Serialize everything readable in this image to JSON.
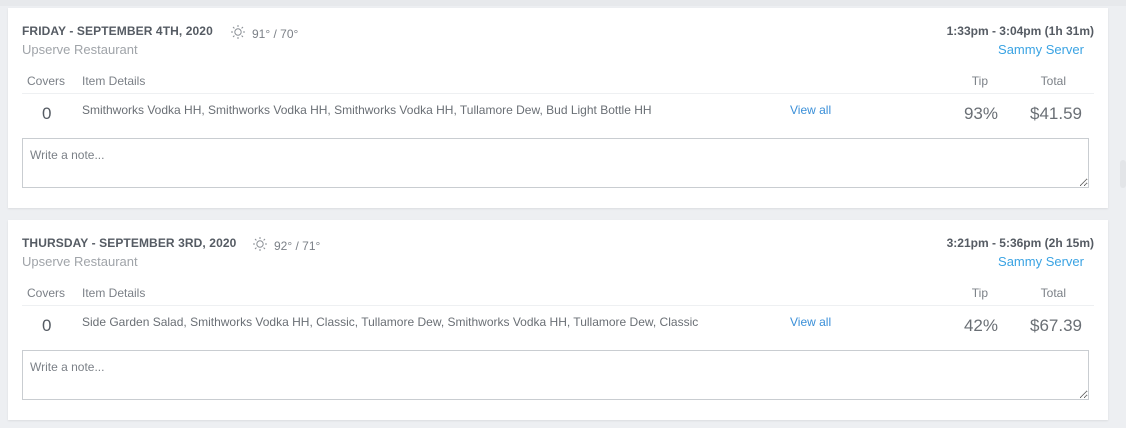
{
  "orders": [
    {
      "date": "FRIDAY - SEPTEMBER 4TH, 2020",
      "weather": "91° / 70°",
      "restaurant": "Upserve Restaurant",
      "time": "1:33pm - 3:04pm (1h 31m)",
      "server": "Sammy Server",
      "headers": {
        "covers": "Covers",
        "items": "Item Details",
        "tip": "Tip",
        "total": "Total"
      },
      "covers": "0",
      "items": "Smithworks Vodka HH, Smithworks Vodka HH, Smithworks Vodka HH, Tullamore Dew, Bud Light Bottle HH",
      "view_all": "View all",
      "tip": "93%",
      "total": "$41.59",
      "note_placeholder": "Write a note..."
    },
    {
      "date": "THURSDAY - SEPTEMBER 3RD, 2020",
      "weather": "92° / 71°",
      "restaurant": "Upserve Restaurant",
      "time": "3:21pm - 5:36pm (2h 15m)",
      "server": "Sammy Server",
      "headers": {
        "covers": "Covers",
        "items": "Item Details",
        "tip": "Tip",
        "total": "Total"
      },
      "covers": "0",
      "items": "Side Garden Salad, Smithworks Vodka HH, Classic, Tullamore Dew, Smithworks Vodka HH, Tullamore Dew, Classic",
      "view_all": "View all",
      "tip": "42%",
      "total": "$67.39",
      "note_placeholder": "Write a note..."
    }
  ],
  "colors": {
    "link": "#3a8fd8",
    "server": "#3aa3e3",
    "background": "#edeff2"
  },
  "icons": {
    "weather": "sun-icon"
  }
}
